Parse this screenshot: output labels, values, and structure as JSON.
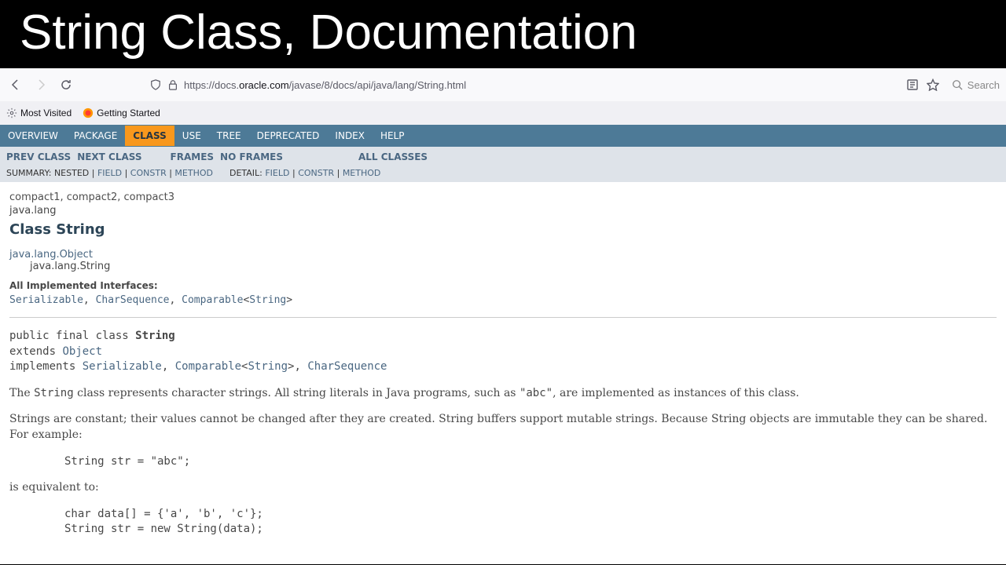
{
  "banner_title": "String Class, Documentation",
  "url": {
    "prefix": "https://docs.",
    "domain": "oracle.com",
    "path": "/javase/8/docs/api/java/lang/String.html"
  },
  "search_placeholder": "Search",
  "bookmarks": {
    "most_visited": "Most Visited",
    "getting_started": "Getting Started"
  },
  "top_nav": {
    "overview": "OVERVIEW",
    "package": "PACKAGE",
    "class": "CLASS",
    "use": "USE",
    "tree": "TREE",
    "deprecated": "DEPRECATED",
    "index": "INDEX",
    "help": "HELP"
  },
  "sub_nav": {
    "prev_class": "PREV CLASS",
    "next_class": "NEXT CLASS",
    "frames": "FRAMES",
    "no_frames": "NO FRAMES",
    "all_classes": "ALL CLASSES"
  },
  "summary": {
    "label": "SUMMARY: ",
    "nested": "NESTED",
    "field": "FIELD",
    "constr": "CONSTR",
    "method": "METHOD",
    "detail_label": "DETAIL: "
  },
  "doc": {
    "compact": "compact1, compact2, compact3",
    "pkg": "java.lang",
    "class_title": "Class String",
    "super_link": "java.lang.Object",
    "this_fqn": "java.lang.String",
    "interfaces_label": "All Implemented Interfaces:",
    "iface_serializable": "Serializable",
    "iface_charsequence": "CharSequence",
    "iface_comparable": "Comparable",
    "iface_comparable_param": "String",
    "sig_public": "public final class ",
    "sig_classname": "String",
    "sig_extends": "extends ",
    "sig_object": "Object",
    "sig_implements": "implements ",
    "desc1a": "The ",
    "desc1_code1": "String",
    "desc1b": " class represents character strings. All string literals in Java programs, such as ",
    "desc1_code2": "\"abc\"",
    "desc1c": ", are implemented as instances of this class.",
    "desc2": "Strings are constant; their values cannot be changed after they are created. String buffers support mutable strings. Because String objects are immutable they can be shared. For example:",
    "code1": "String str = \"abc\";",
    "equiv": "is equivalent to:",
    "code2": "char data[] = {'a', 'b', 'c'};\nString str = new String(data);"
  }
}
